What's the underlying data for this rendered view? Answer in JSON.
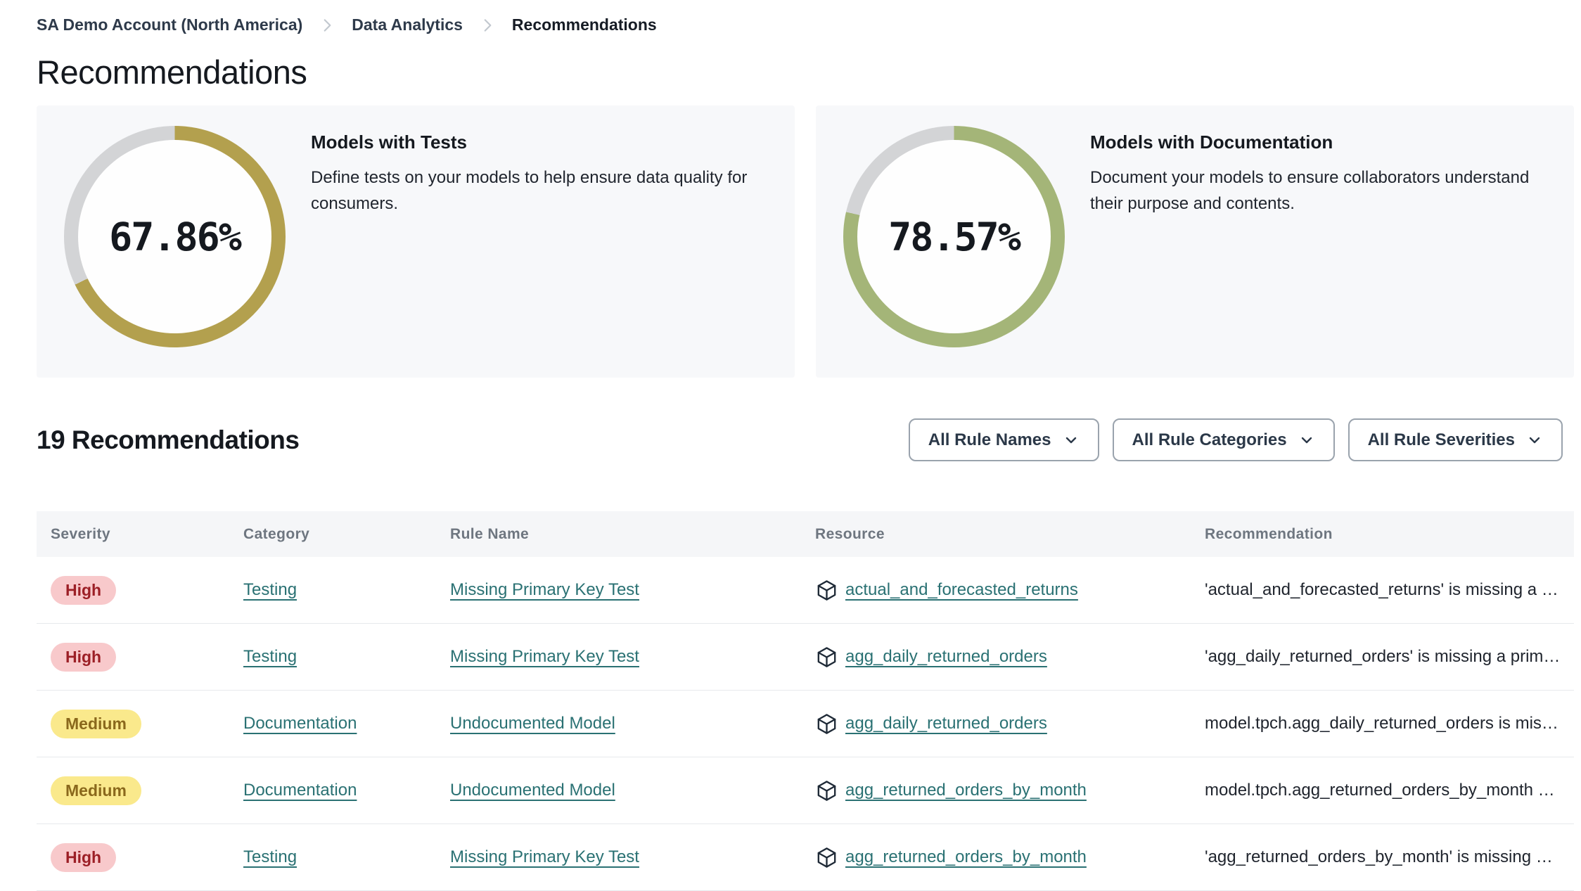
{
  "colors": {
    "link": "#2a7173",
    "card_bg": "#f7f8fa",
    "ring_track": "#d3d4d6",
    "high_bg": "#f8c9cb",
    "high_text": "#9c1f26",
    "medium_bg": "#fae98c",
    "medium_text": "#8a681c"
  },
  "icons": {
    "breadcrumb_separator": "chevron-right-icon",
    "filter_caret": "chevron-down-icon",
    "resource": "cube-icon"
  },
  "breadcrumb": {
    "items": [
      {
        "label": "SA Demo Account (North America)"
      },
      {
        "label": "Data Analytics"
      },
      {
        "label": "Recommendations"
      }
    ]
  },
  "page_title": "Recommendations",
  "cards": [
    {
      "title": "Models with Tests",
      "description": "Define tests on your models to help ensure data quality for consumers.",
      "percent": 67.86,
      "percent_label": "67.86%",
      "ring_color": "#b3a04e"
    },
    {
      "title": "Models with Documentation",
      "description": "Document your models to ensure collaborators understand their purpose and contents.",
      "percent": 78.57,
      "percent_label": "78.57%",
      "ring_color": "#a4b578"
    }
  ],
  "list_header": {
    "count_label": "19 Recommendations"
  },
  "filters": [
    {
      "label": "All Rule Names"
    },
    {
      "label": "All Rule Categories"
    },
    {
      "label": "All Rule Severities"
    }
  ],
  "table": {
    "columns": [
      "Severity",
      "Category",
      "Rule Name",
      "Resource",
      "Recommendation"
    ],
    "rows": [
      {
        "severity": "High",
        "severity_level": "high",
        "category": "Testing",
        "rule_name": "Missing Primary Key Test",
        "resource": "actual_and_forecasted_returns",
        "recommendation": "'actual_and_forecasted_returns' is missing a …"
      },
      {
        "severity": "High",
        "severity_level": "high",
        "category": "Testing",
        "rule_name": "Missing Primary Key Test",
        "resource": "agg_daily_returned_orders",
        "recommendation": "'agg_daily_returned_orders' is missing a prim…"
      },
      {
        "severity": "Medium",
        "severity_level": "medium",
        "category": "Documentation",
        "rule_name": "Undocumented Model",
        "resource": "agg_daily_returned_orders",
        "recommendation": "model.tpch.agg_daily_returned_orders is mis…"
      },
      {
        "severity": "Medium",
        "severity_level": "medium",
        "category": "Documentation",
        "rule_name": "Undocumented Model",
        "resource": "agg_returned_orders_by_month",
        "recommendation": "model.tpch.agg_returned_orders_by_month …"
      },
      {
        "severity": "High",
        "severity_level": "high",
        "category": "Testing",
        "rule_name": "Missing Primary Key Test",
        "resource": "agg_returned_orders_by_month",
        "recommendation": "'agg_returned_orders_by_month' is missing …"
      }
    ]
  }
}
